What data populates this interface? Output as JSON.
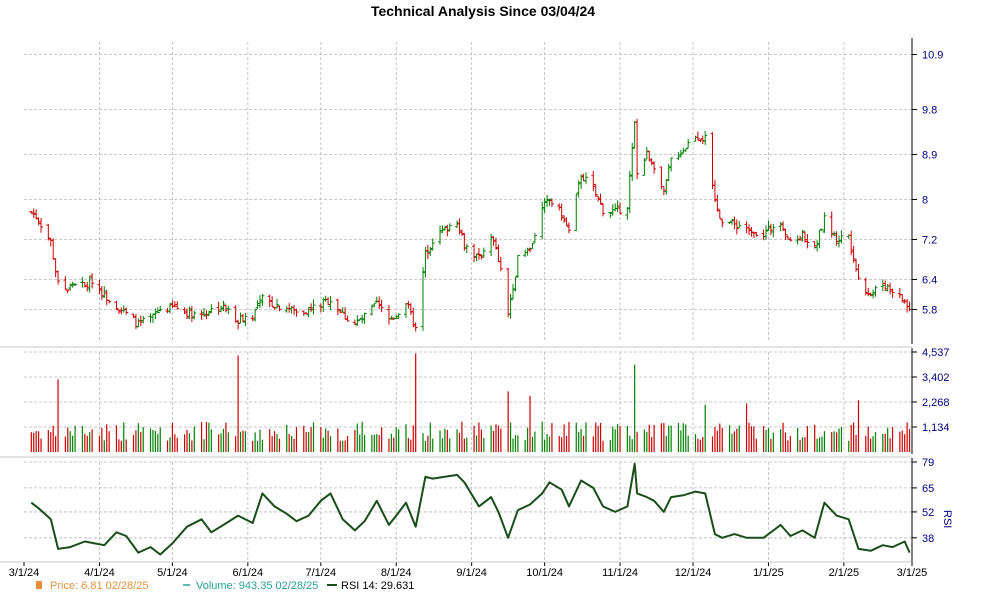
{
  "title": "Technical Analysis Since 03/04/24",
  "colors": {
    "up": "#008000",
    "down": "#cc0000",
    "grid": "#b8b8b8",
    "axis_text": "#000080",
    "rsi": "#1a4d1a",
    "price_legend": "#e8913a",
    "volume_legend": "#2aa198"
  },
  "chart_data": {
    "type": "ohlc",
    "price_axis": {
      "ticks": [
        5.8,
        6.4,
        7.2,
        8.0,
        8.9,
        9.8,
        10.9
      ],
      "ylim": [
        5.15,
        11.15
      ]
    },
    "volume_axis": {
      "ticks": [
        "1,134",
        "2,268",
        "3,402",
        "4,537"
      ],
      "values": [
        1134,
        2268,
        3402,
        4537
      ],
      "ylim": [
        0,
        4537
      ]
    },
    "rsi_axis": {
      "label": "RSI",
      "ticks": [
        38,
        52,
        65,
        79
      ],
      "ylim": [
        26,
        79
      ]
    },
    "date_labels": [
      "3/1/24",
      "4/1/24",
      "5/1/24",
      "6/1/24",
      "7/1/24",
      "8/1/24",
      "9/1/24",
      "10/1/24",
      "11/1/24",
      "12/1/24",
      "1/1/25",
      "2/1/25",
      "3/1/25"
    ],
    "close_series": [
      [
        "2024-03-04",
        7.75
      ],
      [
        "2024-03-07",
        7.6
      ],
      [
        "2024-03-12",
        7.15
      ],
      [
        "2024-03-15",
        6.3
      ],
      [
        "2024-03-19",
        6.2
      ],
      [
        "2024-03-22",
        6.35
      ],
      [
        "2024-03-26",
        6.25
      ],
      [
        "2024-03-29",
        6.4
      ],
      [
        "2024-04-03",
        6.1
      ],
      [
        "2024-04-08",
        5.9
      ],
      [
        "2024-04-12",
        5.7
      ],
      [
        "2024-04-17",
        5.5
      ],
      [
        "2024-04-22",
        5.6
      ],
      [
        "2024-04-26",
        5.8
      ],
      [
        "2024-05-02",
        5.85
      ],
      [
        "2024-05-07",
        5.75
      ],
      [
        "2024-05-13",
        5.7
      ],
      [
        "2024-05-17",
        5.8
      ],
      [
        "2024-05-22",
        5.85
      ],
      [
        "2024-05-28",
        5.6
      ],
      [
        "2024-06-03",
        5.7
      ],
      [
        "2024-06-07",
        6.0
      ],
      [
        "2024-06-12",
        5.9
      ],
      [
        "2024-06-17",
        5.85
      ],
      [
        "2024-06-21",
        5.75
      ],
      [
        "2024-06-26",
        5.8
      ],
      [
        "2024-07-01",
        5.9
      ],
      [
        "2024-07-05",
        6.0
      ],
      [
        "2024-07-10",
        5.7
      ],
      [
        "2024-07-15",
        5.5
      ],
      [
        "2024-07-19",
        5.65
      ],
      [
        "2024-07-24",
        5.9
      ],
      [
        "2024-07-29",
        5.6
      ],
      [
        "2024-08-01",
        5.7
      ],
      [
        "2024-08-05",
        5.95
      ],
      [
        "2024-08-09",
        5.4
      ],
      [
        "2024-08-13",
        6.9
      ],
      [
        "2024-08-16",
        7.2
      ],
      [
        "2024-08-21",
        7.4
      ],
      [
        "2024-08-26",
        7.6
      ],
      [
        "2024-08-29",
        7.1
      ],
      [
        "2024-09-04",
        6.8
      ],
      [
        "2024-09-09",
        7.3
      ],
      [
        "2024-09-12",
        6.8
      ],
      [
        "2024-09-16",
        5.75
      ],
      [
        "2024-09-20",
        6.8
      ],
      [
        "2024-09-25",
        7.0
      ],
      [
        "2024-09-30",
        7.8
      ],
      [
        "2024-10-03",
        8.0
      ],
      [
        "2024-10-08",
        7.7
      ],
      [
        "2024-10-11",
        7.35
      ],
      [
        "2024-10-16",
        8.5
      ],
      [
        "2024-10-21",
        8.2
      ],
      [
        "2024-10-25",
        7.8
      ],
      [
        "2024-10-30",
        7.75
      ],
      [
        "2024-11-04",
        7.9
      ],
      [
        "2024-11-07",
        9.5
      ],
      [
        "2024-11-08",
        8.5
      ],
      [
        "2024-11-12",
        8.9
      ],
      [
        "2024-11-15",
        8.7
      ],
      [
        "2024-11-19",
        8.1
      ],
      [
        "2024-11-22",
        8.8
      ],
      [
        "2024-11-27",
        9.0
      ],
      [
        "2024-12-02",
        9.3
      ],
      [
        "2024-12-06",
        9.2
      ],
      [
        "2024-12-10",
        7.9
      ],
      [
        "2024-12-13",
        7.6
      ],
      [
        "2024-12-18",
        7.5
      ],
      [
        "2024-12-23",
        7.45
      ],
      [
        "2024-12-30",
        7.3
      ],
      [
        "2025-01-06",
        7.6
      ],
      [
        "2025-01-10",
        7.1
      ],
      [
        "2025-01-15",
        7.3
      ],
      [
        "2025-01-20",
        7.0
      ],
      [
        "2025-01-24",
        7.6
      ],
      [
        "2025-01-29",
        7.2
      ],
      [
        "2025-02-03",
        7.3
      ],
      [
        "2025-02-07",
        6.4
      ],
      [
        "2025-02-12",
        6.1
      ],
      [
        "2025-02-17",
        6.3
      ],
      [
        "2025-02-21",
        6.2
      ],
      [
        "2025-02-26",
        5.95
      ],
      [
        "2025-02-28",
        5.8
      ]
    ],
    "volume_spikes": [
      [
        "2024-03-15",
        3300
      ],
      [
        "2024-05-28",
        4380
      ],
      [
        "2024-08-09",
        4470
      ],
      [
        "2024-09-16",
        2750
      ],
      [
        "2024-09-25",
        2550
      ],
      [
        "2024-11-07",
        3960
      ],
      [
        "2024-12-06",
        2150
      ],
      [
        "2024-12-23",
        2200
      ],
      [
        "2025-02-07",
        2350
      ]
    ],
    "rsi_series": [
      [
        "2024-03-04",
        57
      ],
      [
        "2024-03-07",
        54
      ],
      [
        "2024-03-12",
        48
      ],
      [
        "2024-03-15",
        32
      ],
      [
        "2024-03-20",
        33
      ],
      [
        "2024-03-26",
        36
      ],
      [
        "2024-04-03",
        34
      ],
      [
        "2024-04-08",
        41
      ],
      [
        "2024-04-12",
        39
      ],
      [
        "2024-04-17",
        30
      ],
      [
        "2024-04-22",
        33
      ],
      [
        "2024-04-26",
        29
      ],
      [
        "2024-05-01",
        35
      ],
      [
        "2024-05-07",
        44
      ],
      [
        "2024-05-13",
        48
      ],
      [
        "2024-05-17",
        41
      ],
      [
        "2024-05-22",
        45
      ],
      [
        "2024-05-28",
        50
      ],
      [
        "2024-06-03",
        46
      ],
      [
        "2024-06-07",
        62
      ],
      [
        "2024-06-12",
        55
      ],
      [
        "2024-06-17",
        51
      ],
      [
        "2024-06-21",
        47
      ],
      [
        "2024-06-26",
        50
      ],
      [
        "2024-07-01",
        58
      ],
      [
        "2024-07-05",
        62
      ],
      [
        "2024-07-10",
        48
      ],
      [
        "2024-07-15",
        42
      ],
      [
        "2024-07-19",
        47
      ],
      [
        "2024-07-24",
        58
      ],
      [
        "2024-07-29",
        45
      ],
      [
        "2024-08-01",
        50
      ],
      [
        "2024-08-05",
        57
      ],
      [
        "2024-08-09",
        44
      ],
      [
        "2024-08-13",
        71
      ],
      [
        "2024-08-16",
        70
      ],
      [
        "2024-08-21",
        71
      ],
      [
        "2024-08-26",
        72
      ],
      [
        "2024-08-29",
        68
      ],
      [
        "2024-09-04",
        55
      ],
      [
        "2024-09-09",
        60
      ],
      [
        "2024-09-12",
        52
      ],
      [
        "2024-09-16",
        38
      ],
      [
        "2024-09-20",
        53
      ],
      [
        "2024-09-25",
        56
      ],
      [
        "2024-09-30",
        62
      ],
      [
        "2024-10-03",
        68
      ],
      [
        "2024-10-08",
        64
      ],
      [
        "2024-10-11",
        55
      ],
      [
        "2024-10-16",
        69
      ],
      [
        "2024-10-21",
        65
      ],
      [
        "2024-10-25",
        55
      ],
      [
        "2024-10-30",
        52
      ],
      [
        "2024-11-04",
        55
      ],
      [
        "2024-11-07",
        78
      ],
      [
        "2024-11-08",
        62
      ],
      [
        "2024-11-12",
        60
      ],
      [
        "2024-11-15",
        58
      ],
      [
        "2024-11-19",
        52
      ],
      [
        "2024-11-22",
        60
      ],
      [
        "2024-11-27",
        61
      ],
      [
        "2024-12-02",
        63
      ],
      [
        "2024-12-06",
        62
      ],
      [
        "2024-12-10",
        40
      ],
      [
        "2024-12-13",
        38
      ],
      [
        "2024-12-18",
        40
      ],
      [
        "2024-12-23",
        38
      ],
      [
        "2024-12-30",
        38
      ],
      [
        "2025-01-06",
        45
      ],
      [
        "2025-01-10",
        39
      ],
      [
        "2025-01-15",
        42
      ],
      [
        "2025-01-20",
        38
      ],
      [
        "2025-01-24",
        57
      ],
      [
        "2025-01-29",
        50
      ],
      [
        "2025-02-03",
        48
      ],
      [
        "2025-02-07",
        32
      ],
      [
        "2025-02-12",
        31
      ],
      [
        "2025-02-17",
        34
      ],
      [
        "2025-02-21",
        33
      ],
      [
        "2025-02-26",
        36
      ],
      [
        "2025-02-28",
        30
      ]
    ]
  },
  "legend": {
    "price": "Price: 6.81  02/28/25",
    "volume": "Volume: 943.35  02/28/25",
    "rsi": "RSI 14: 29.631"
  }
}
